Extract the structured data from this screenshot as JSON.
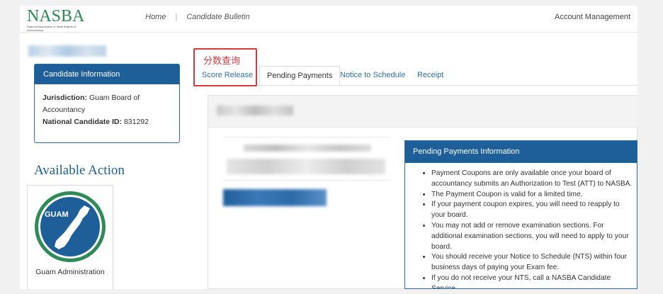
{
  "header": {
    "logo_text": "NASBA",
    "logo_subtext": "National Association of State Boards of Accountancy",
    "nav_home": "Home",
    "nav_separator": "|",
    "nav_bulletin": "Candidate Bulletin",
    "account": "Account Management"
  },
  "candidate": {
    "title": "Candidate Information",
    "jurisdiction_label": "Jurisdiction:",
    "jurisdiction_value": "Guam Board of Accountancy",
    "id_label": "National Candidate ID:",
    "id_value": "831292"
  },
  "available_action": {
    "heading": "Available Action",
    "badge_text": "GUAM",
    "card_label": "Guam Administration"
  },
  "annotation": {
    "label": "分数查询",
    "color": "#d63a3a"
  },
  "tabs": [
    {
      "label": "Score Release",
      "active": false
    },
    {
      "label": "Pending Payments",
      "active": true
    },
    {
      "label": "Notice to Schedule",
      "active": false
    },
    {
      "label": "Receipt",
      "active": false
    }
  ],
  "pending_info": {
    "title": "Pending Payments Information",
    "items": [
      "Payment Coupons are only available once your board of accountancy submits an Authorization to Test (ATT) to NASBA.",
      "The Payment Coupon is valid for a limited time.",
      "If your payment coupon expires, you will need to reapply to your board.",
      "You may not add or remove examination sections. For additional examination sections, you will need to apply to your board.",
      "You should receive your Notice to Schedule (NTS) within four business days of paying your Exam fee.",
      "If you do not receive your NTS, call a NASBA Candidate Service"
    ]
  },
  "colors": {
    "primary": "#1f5f99",
    "link": "#2d6fa8",
    "brand_green": "#2e8b57",
    "heading_blue": "#1d5f8f"
  }
}
